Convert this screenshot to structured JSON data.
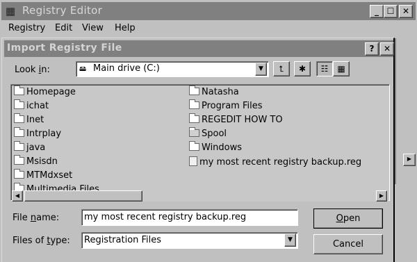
{
  "main_window": {
    "title": "Registry Editor",
    "menu": [
      "Registry",
      "Edit",
      "View",
      "Help"
    ],
    "caption_buttons": {
      "minimize": "_",
      "maximize": "☐",
      "close": "✕"
    }
  },
  "dialog": {
    "title": "Import Registry File",
    "caption_buttons": {
      "help": "?",
      "close": "✕"
    },
    "look_in": {
      "label_pre": "Look ",
      "label_u": "i",
      "label_post": "n:",
      "value": "Main drive (C:)"
    },
    "files_left": [
      "Homepage",
      "ichat",
      "Inet",
      "Intrplay",
      "java",
      "Msisdn",
      "MTMdxset",
      "Multimedia Files"
    ],
    "files_right": [
      {
        "name": "Natasha",
        "icon": "folder"
      },
      {
        "name": "Program Files",
        "icon": "folder"
      },
      {
        "name": "REGEDIT HOW TO",
        "icon": "folder"
      },
      {
        "name": "Spool",
        "icon": "spool-folder"
      },
      {
        "name": "Windows",
        "icon": "folder"
      },
      {
        "name": "my most recent registry backup.reg",
        "icon": "reg-file"
      }
    ],
    "file_name": {
      "label_pre": "File ",
      "label_u": "n",
      "label_post": "ame:",
      "value": "my most recent registry backup.reg"
    },
    "file_type": {
      "label_pre": "Files of ",
      "label_u": "t",
      "label_post": "ype:",
      "value": "Registration Files"
    },
    "buttons": {
      "open_u": "O",
      "open_rest": "pen",
      "cancel": "Cancel"
    }
  }
}
